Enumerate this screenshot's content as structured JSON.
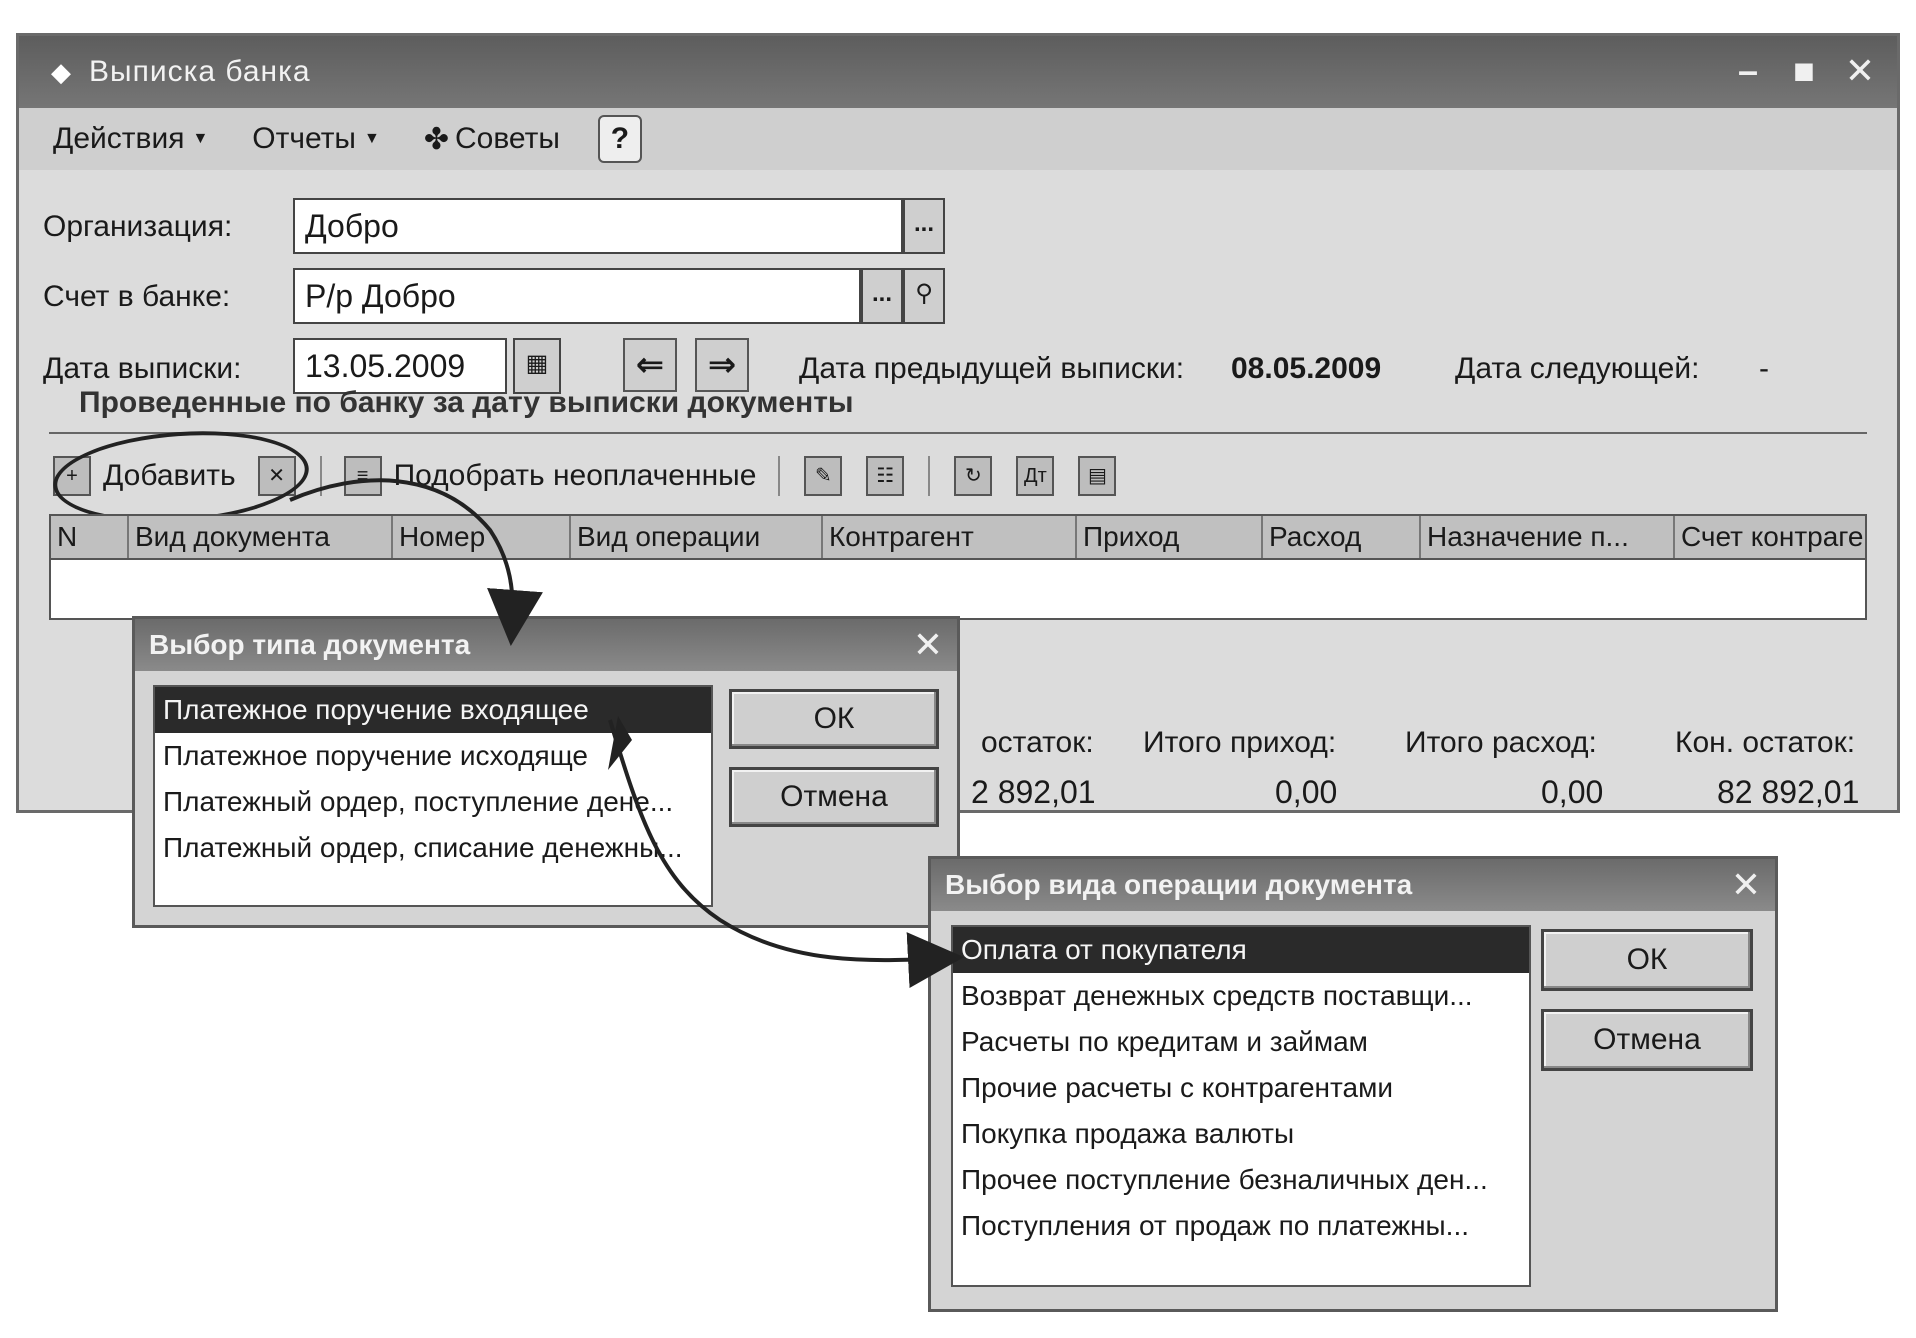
{
  "window": {
    "title": "Выписка банка",
    "menu": {
      "actions": "Действия",
      "reports": "Отчеты",
      "tips": "Советы",
      "help": "?"
    }
  },
  "form": {
    "org_label": "Организация:",
    "org_value": "Добро",
    "account_label": "Счет в банке:",
    "account_value": "Р/р Добро",
    "date_label": "Дата выписки:",
    "date_value": "13.05.2009",
    "prev_label": "Дата предыдущей выписки:",
    "prev_value": "08.05.2009",
    "next_label": "Дата следующей:",
    "next_value": "-",
    "ellipsis": "..."
  },
  "section_title": "Проведенные по банку за дату выписки документы",
  "toolbar": {
    "add": "Добавить",
    "pick_unpaid": "Подобрать неоплаченные"
  },
  "grid": {
    "columns": [
      "N",
      "Вид документа",
      "Номер",
      "Вид операции",
      "Контрагент",
      "Приход",
      "Расход",
      "Назначение п...",
      "Счет контраге..."
    ]
  },
  "totals": {
    "opening_label": "остаток:",
    "opening_value": "2 892,01",
    "income_label": "Итого приход:",
    "income_value": "0,00",
    "expense_label": "Итого расход:",
    "expense_value": "0,00",
    "closing_label": "Кон. остаток:",
    "closing_value": "82 892,01"
  },
  "dialog1": {
    "title": "Выбор типа документа",
    "items": [
      "Платежное поручение входящее",
      "Платежное поручение исходяще",
      "Платежный ордер, поступление дене...",
      "Платежный ордер, списание денежны..."
    ],
    "ok": "ОК",
    "cancel": "Отмена"
  },
  "dialog2": {
    "title": "Выбор вида операции документа",
    "items": [
      "Оплата от покупателя",
      "Возврат денежных средств поставщи...",
      "Расчеты по кредитам и займам",
      "Прочие расчеты с контрагентами",
      "Покупка продажа валюты",
      "Прочее поступление безналичных ден...",
      "Поступления от продаж по платежны..."
    ],
    "ok": "ОК",
    "cancel": "Отмена"
  }
}
